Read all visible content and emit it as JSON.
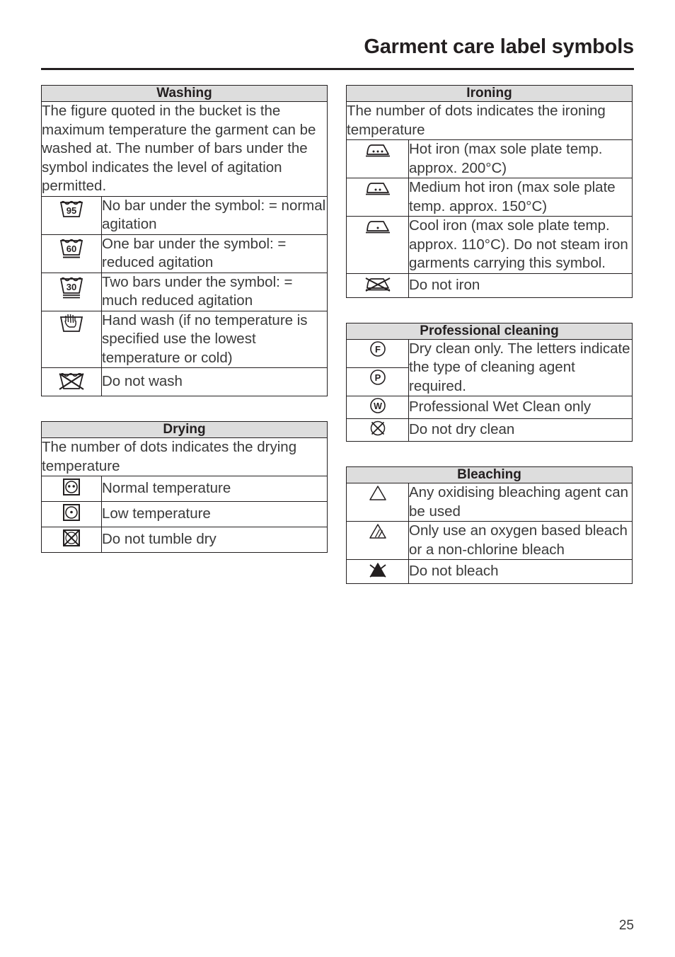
{
  "header": {
    "title": "Garment care label symbols"
  },
  "footer": {
    "page_number": "25"
  },
  "colors": {
    "header_fill": "#dddddd",
    "text": "#3a3a3a",
    "rule": "#231f20"
  },
  "sections": {
    "washing": {
      "heading": "Washing",
      "intro": "The figure quoted in the bucket is the maximum temperature the garment can be washed at. The number of bars under the symbol indicates the level of agitation permitted.",
      "rows": [
        {
          "icon": "wash-tub-95-icon",
          "temp": "95",
          "bars": 0,
          "text": "No bar under the symbol: = normal agitation"
        },
        {
          "icon": "wash-tub-60-icon",
          "temp": "60",
          "bars": 1,
          "text": "One bar under the symbol: = reduced agitation"
        },
        {
          "icon": "wash-tub-30-icon",
          "temp": "30",
          "bars": 2,
          "text": "Two bars under the symbol: = much reduced agitation"
        },
        {
          "icon": "hand-wash-icon",
          "temp": "",
          "bars": 0,
          "text": "Hand wash (if no temperature is specified use the lowest temperature or cold)"
        },
        {
          "icon": "do-not-wash-icon",
          "temp": "",
          "bars": 0,
          "text": "Do not wash"
        }
      ]
    },
    "drying": {
      "heading": "Drying",
      "intro": "The number of dots indicates the drying temperature",
      "rows": [
        {
          "icon": "tumble-dry-normal-icon",
          "dots": 2,
          "text": "Normal temperature"
        },
        {
          "icon": "tumble-dry-low-icon",
          "dots": 1,
          "text": "Low temperature"
        },
        {
          "icon": "do-not-tumble-dry-icon",
          "dots": 0,
          "text": "Do not tumble dry"
        }
      ]
    },
    "ironing": {
      "heading": "Ironing",
      "intro": "The number of dots indicates the ironing temperature",
      "rows": [
        {
          "icon": "iron-hot-icon",
          "dots": 3,
          "text": "Hot iron (max sole plate temp. approx. 200°C)"
        },
        {
          "icon": "iron-medium-icon",
          "dots": 2,
          "text": "Medium hot iron (max sole plate temp. approx. 150°C)"
        },
        {
          "icon": "iron-cool-icon",
          "dots": 1,
          "text": "Cool iron (max sole plate temp. approx. 110°C). Do not steam iron garments carrying this symbol."
        },
        {
          "icon": "do-not-iron-icon",
          "dots": 0,
          "text": "Do not iron"
        }
      ]
    },
    "professional_cleaning": {
      "heading": "Professional cleaning",
      "rows": [
        {
          "icon": "dry-clean-f-icon",
          "letter": "F",
          "text": "Dry clean only. The letters indicate the type of cleaning agent required.",
          "merged": true
        },
        {
          "icon": "dry-clean-p-icon",
          "letter": "P",
          "text": ""
        },
        {
          "icon": "wet-clean-w-icon",
          "letter": "W",
          "text": "Professional Wet Clean only"
        },
        {
          "icon": "do-not-dry-clean-icon",
          "letter": "",
          "text": "Do not dry clean"
        }
      ]
    },
    "bleaching": {
      "heading": "Bleaching",
      "rows": [
        {
          "icon": "bleach-any-icon",
          "text": "Any oxidising bleaching agent can be used"
        },
        {
          "icon": "bleach-oxygen-only-icon",
          "text": "Only use an oxygen based bleach or a non-chlorine bleach"
        },
        {
          "icon": "do-not-bleach-icon",
          "text": "Do not bleach"
        }
      ]
    }
  }
}
